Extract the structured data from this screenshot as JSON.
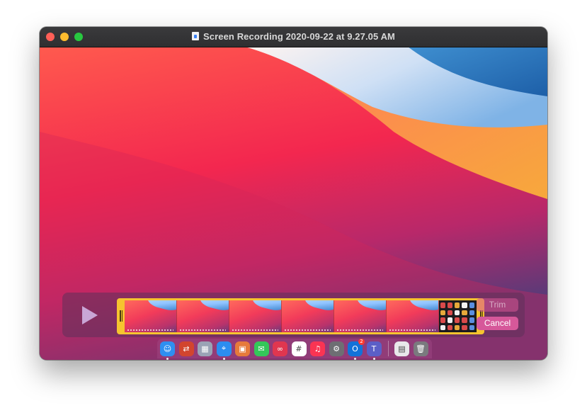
{
  "window": {
    "title": "Screen Recording 2020-09-22 at 9.27.05 AM"
  },
  "trim": {
    "trim_label": "Trim",
    "cancel_label": "Cancel"
  },
  "dock": {
    "items": [
      {
        "name": "finder-icon",
        "glyph": "☺",
        "color": "#2f8ff0",
        "running": true
      },
      {
        "name": "remote-desktop-icon",
        "glyph": "⇄",
        "color": "#d2452e",
        "running": false
      },
      {
        "name": "launchpad-icon",
        "glyph": "▦",
        "color": "#9aa3b5",
        "running": false
      },
      {
        "name": "safari-icon",
        "glyph": "⌖",
        "color": "#2c8df0",
        "running": true
      },
      {
        "name": "package-icon",
        "glyph": "▣",
        "color": "#e67a3b",
        "running": false
      },
      {
        "name": "messages-icon",
        "glyph": "✉",
        "color": "#34c759",
        "running": false
      },
      {
        "name": "creative-cloud-icon",
        "glyph": "∞",
        "color": "#e0364f",
        "running": false
      },
      {
        "name": "slack-icon",
        "glyph": "#",
        "color": "#ffffff",
        "running": false
      },
      {
        "name": "music-icon",
        "glyph": "♫",
        "color": "#fa3453",
        "running": false
      },
      {
        "name": "system-preferences-icon",
        "glyph": "⚙",
        "color": "#6e6e73",
        "running": false
      },
      {
        "name": "outlook-icon",
        "glyph": "O",
        "color": "#1272d8",
        "running": true,
        "badge": "2"
      },
      {
        "name": "teams-icon",
        "glyph": "T",
        "color": "#5b5fc7",
        "running": true
      }
    ],
    "trailing": [
      {
        "name": "document-stack-icon",
        "glyph": "▤",
        "color": "#e8e8ea"
      },
      {
        "name": "trash-icon",
        "glyph": "🗑",
        "color": "#7a7a7e"
      }
    ]
  }
}
